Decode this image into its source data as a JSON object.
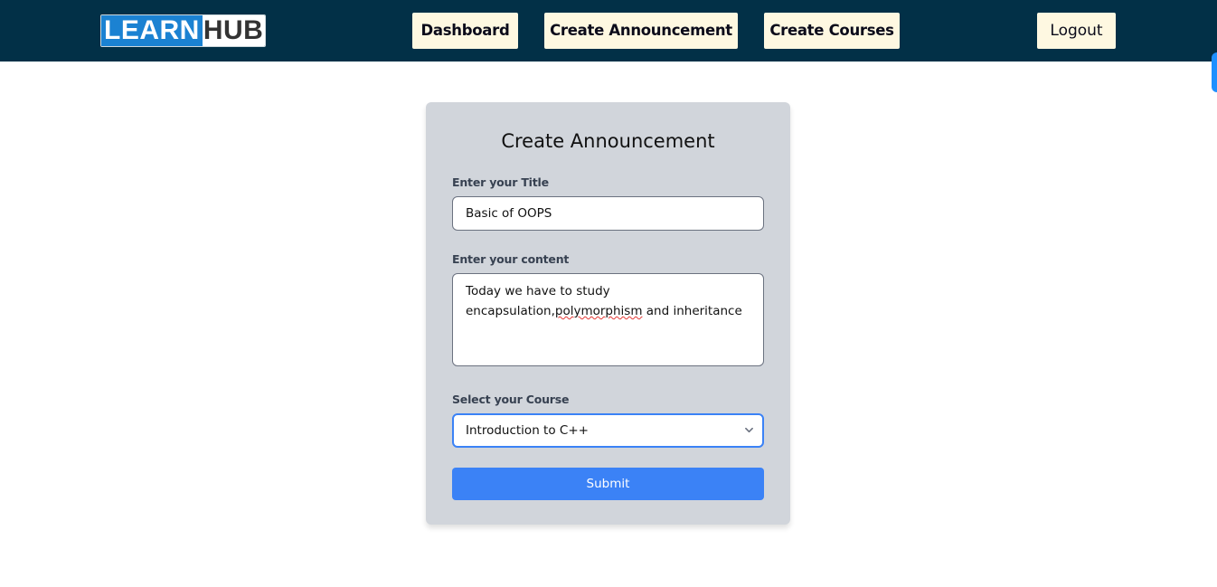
{
  "navbar": {
    "logo": {
      "part1": "LEARN",
      "part2": "HUB"
    },
    "links": [
      {
        "label": "Dashboard"
      },
      {
        "label": "Create Announcement"
      },
      {
        "label": "Create Courses"
      }
    ],
    "logout_label": "Logout"
  },
  "form": {
    "title": "Create Announcement",
    "title_field": {
      "label": "Enter your Title",
      "value": "Basic of OOPS"
    },
    "content_field": {
      "label": "Enter your content",
      "line1": "Today we have to study",
      "line2_pre": "encapsulation,",
      "line2_misspelled": "polymorphism",
      "line2_post": " and inheritance"
    },
    "course_field": {
      "label": "Select your Course",
      "selected": "Introduction to C++"
    },
    "submit_label": "Submit"
  },
  "colors": {
    "navbar_bg": "#023047",
    "nav_button_bg": "#fef8e1",
    "card_bg": "#d1d5db",
    "primary": "#3b82f6"
  }
}
